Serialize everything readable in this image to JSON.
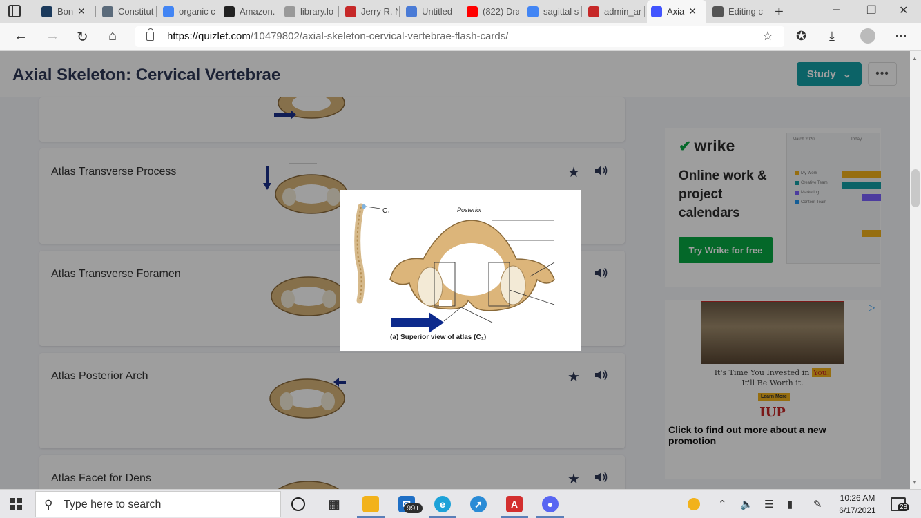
{
  "browser": {
    "tabs": [
      {
        "label": "Bon",
        "favicon_color": "#1b3a5c",
        "has_close": true
      },
      {
        "label": "Constitut",
        "favicon_color": "#5b6b7b",
        "has_close": false
      },
      {
        "label": "organic c",
        "favicon_color": "#4285f4",
        "has_close": false
      },
      {
        "label": "Amazon.",
        "favicon_color": "#222222",
        "has_close": false
      },
      {
        "label": "library.lo",
        "favicon_color": "#999999",
        "has_close": false
      },
      {
        "label": "Jerry R. N",
        "favicon_color": "#c62828",
        "has_close": false
      },
      {
        "label": "Untitled",
        "favicon_color": "#4a7bd6",
        "has_close": false
      },
      {
        "label": "(822) Dra",
        "favicon_color": "#ff0000",
        "has_close": false
      },
      {
        "label": "sagittal s",
        "favicon_color": "#4285f4",
        "has_close": false
      },
      {
        "label": "admin_ar",
        "favicon_color": "#c62828",
        "has_close": false
      },
      {
        "label": "Axia",
        "favicon_color": "#4255ff",
        "has_close": true,
        "active": true
      },
      {
        "label": "Editing c",
        "favicon_color": "#555555",
        "has_close": false
      }
    ],
    "url_host": "https://quizlet.com",
    "url_path": "/10479802/axial-skeleton-cervical-vertebrae-flash-cards/"
  },
  "page": {
    "title": "Axial Skeleton: Cervical Vertebrae",
    "study_label": "Study",
    "more_label": "•••",
    "cards": [
      {
        "term": ""
      },
      {
        "term": "Atlas Transverse Process"
      },
      {
        "term": "Atlas Transverse Foramen"
      },
      {
        "term": "Atlas Posterior Arch"
      },
      {
        "term": "Atlas Facet for Dens"
      }
    ],
    "figure": {
      "spine_label": "C₁",
      "posterior_label": "Posterior",
      "caption": "(a) Superior view of atlas (C₁)"
    }
  },
  "ads": {
    "wrike": {
      "brand": "wrike",
      "headline": "Online work & project calendars",
      "cta": "Try Wrike for free",
      "calendar_month": "March 2020",
      "calendar_today": "Today",
      "calendar_items": [
        "My Work",
        "Creative Team",
        "Marketing",
        "Content Team"
      ]
    },
    "iup": {
      "line1_prefix": "It's Time You Invested in ",
      "line1_highlight": "You.",
      "line2": "It'll Be Worth it.",
      "learn_more": "Learn More",
      "logo": "IUP",
      "caption": "Click to find out more about a new promotion"
    }
  },
  "taskbar": {
    "search_placeholder": "Type here to search",
    "mail_badge": "99+",
    "time": "10:26 AM",
    "date": "6/17/2021",
    "notifications": "28"
  }
}
